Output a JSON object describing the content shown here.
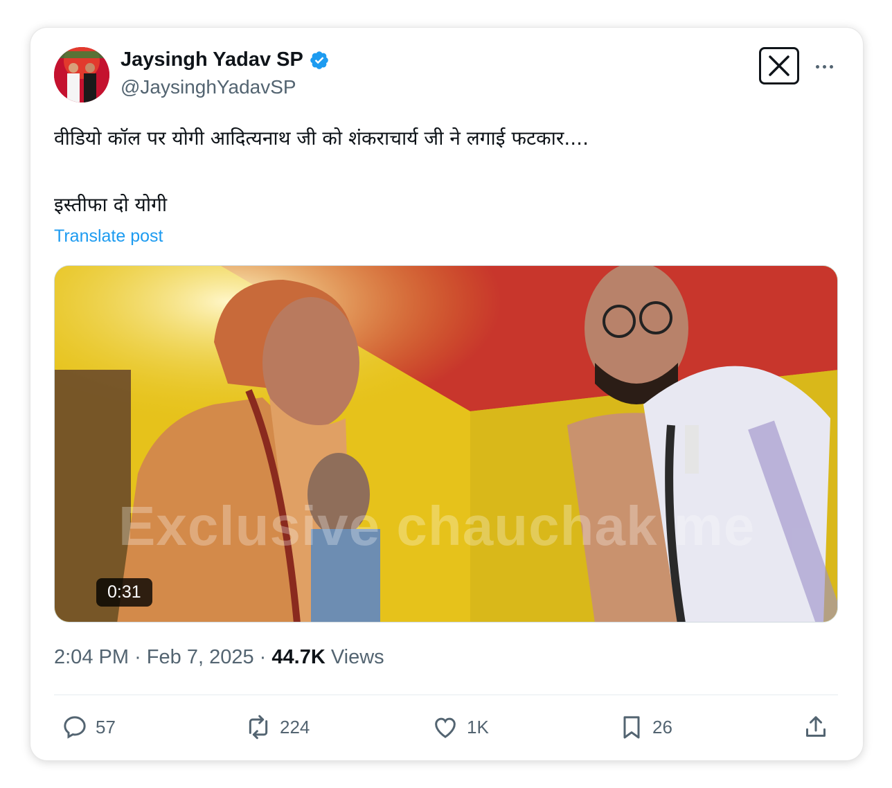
{
  "author": {
    "name": "Jaysingh Yadav SP",
    "handle": "@JaysinghYadavSP",
    "verified": true
  },
  "post": {
    "line1": "वीडियो कॉल पर योगी आदित्यनाथ जी को शंकराचार्य जी ने लगाई फटकार....",
    "line2": "इस्तीफा दो योगी",
    "translate_label": "Translate post"
  },
  "media": {
    "duration": "0:31",
    "watermark": "Exclusive chauchak me"
  },
  "meta": {
    "time": "2:04 PM",
    "separator": "·",
    "date": "Feb 7, 2025",
    "views_count": "44.7K",
    "views_label": "Views"
  },
  "actions": {
    "replies": "57",
    "reposts": "224",
    "likes": "1K",
    "bookmarks": "26"
  },
  "colors": {
    "accent": "#1d9bf0",
    "text": "#0f1419",
    "secondary": "#536471"
  },
  "icons": [
    "verified-badge-icon",
    "x-logo-icon",
    "more-icon",
    "reply-icon",
    "repost-icon",
    "like-icon",
    "bookmark-icon",
    "share-icon"
  ]
}
